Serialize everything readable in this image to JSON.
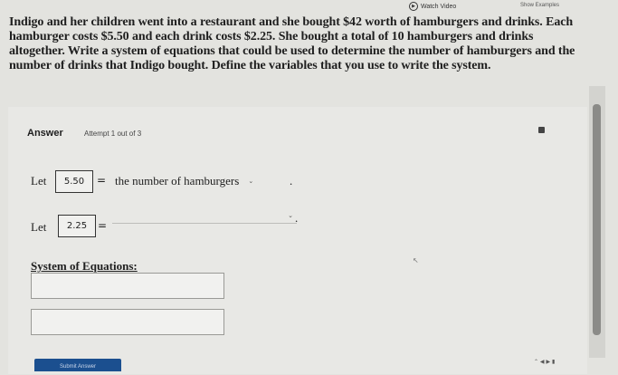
{
  "header": {
    "watch_video_label": "Watch Video",
    "show_examples_label": "Show Examples"
  },
  "question": {
    "text": "Indigo and her children went into a restaurant and she bought $42 worth of hamburgers and drinks. Each hamburger costs $5.50 and each drink costs $2.25. She bought a total of 10 hamburgers and drinks altogether. Write a system of equations that could be used to determine the number of hamburgers and the number of drinks that Indigo bought. Define the variables that you use to write the system."
  },
  "answer": {
    "heading": "Answer",
    "attempt_text": "Attempt 1 out of 3"
  },
  "variables": [
    {
      "let_label": "Let",
      "value": "5.50",
      "equals": "=",
      "selected": "the number of hamburgers",
      "period": "."
    },
    {
      "let_label": "Let",
      "value": "2.25",
      "equals": "=",
      "selected": "",
      "period": "."
    }
  ],
  "system": {
    "title": "System of Equations:"
  },
  "submit": {
    "label": "Submit Answer"
  }
}
